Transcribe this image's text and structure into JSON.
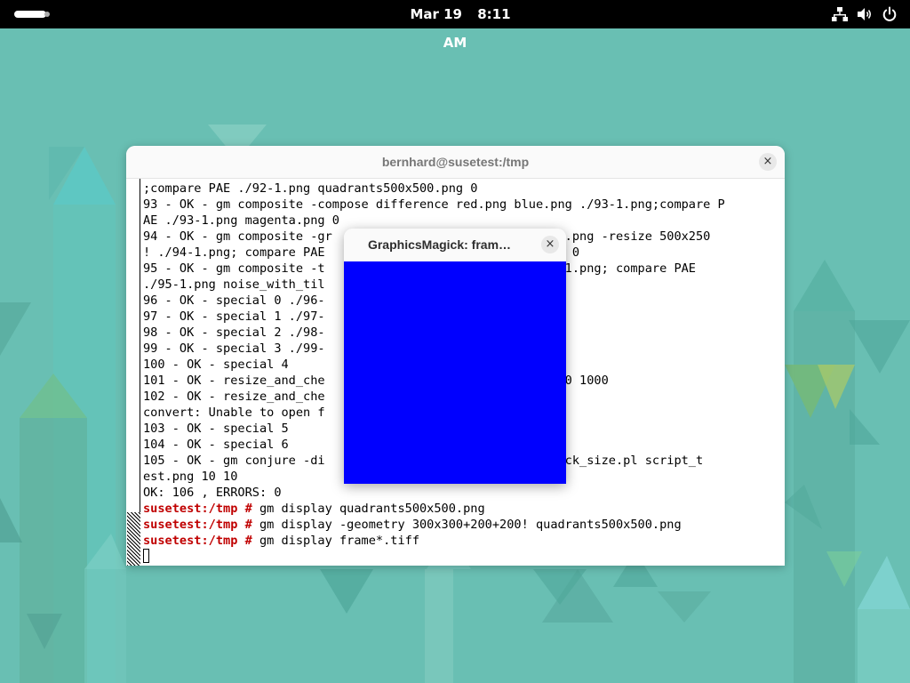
{
  "topbar": {
    "date": "Mar 19",
    "time": "8:11 AM",
    "icons": [
      "network-icon",
      "volume-icon",
      "power-icon"
    ]
  },
  "terminal": {
    "title": "bernhard@susetest:/tmp",
    "close_label": "×",
    "lines": [
      {
        "text": ";compare PAE ./92-1.png quadrants500x500.png 0"
      },
      {
        "text": "93 - OK - gm composite -compose difference red.png blue.png ./93-1.png;compare P"
      },
      {
        "text": "AE ./93-1.png magenta.png 0"
      },
      {
        "text": "94 - OK - gm composite -gr                        ng  blue.png -resize 500x250"
      },
      {
        "text": "! ./94-1.png; compare PAE                         x250.png 0"
      },
      {
        "text": "95 - OK - gm composite -t                         if ./95-1.png; compare PAE"
      },
      {
        "text": "./95-1.png noise_with_til"
      },
      {
        "text": "96 - OK - special 0 ./96-"
      },
      {
        "text": "97 - OK - special 1 ./97-"
      },
      {
        "text": "98 - OK - special 2 ./98-"
      },
      {
        "text": "99 - OK - special 3 ./99-"
      },
      {
        "text": "100 - OK - special 4"
      },
      {
        "text": "101 - OK - resize_and_che                         ng - 5000 1000"
      },
      {
        "text": "102 - OK - resize_and_che                          500 500"
      },
      {
        "text": "convert: Unable to open f"
      },
      {
        "text": "103 - OK - special 5"
      },
      {
        "text": "104 - OK - special 6"
      },
      {
        "text": "105 - OK - gm conjure -di                         perl check_size.pl script_t"
      },
      {
        "text": "est.png 10 10"
      },
      {
        "text": "OK: 106 , ERRORS: 0"
      },
      {
        "prompt": "susetest:/tmp #",
        "text": " gm display quadrants500x500.png"
      },
      {
        "prompt": "susetest:/tmp #",
        "text": " gm display -geometry 300x300+200+200! quadrants500x500.png"
      },
      {
        "prompt": "susetest:/tmp #",
        "text": " gm display frame*.tiff"
      }
    ],
    "colors": {
      "prompt": "#c00000",
      "text": "#000000",
      "background": "#ffffff"
    }
  },
  "gm_window": {
    "title": "GraphicsMagick: fram…",
    "close_label": "×",
    "canvas_color": "#0000ff"
  },
  "desktop": {
    "colors": {
      "background": "#69bfb3",
      "accent_light": "#8fd4c6",
      "accent_dark": "#4fa79a"
    }
  }
}
